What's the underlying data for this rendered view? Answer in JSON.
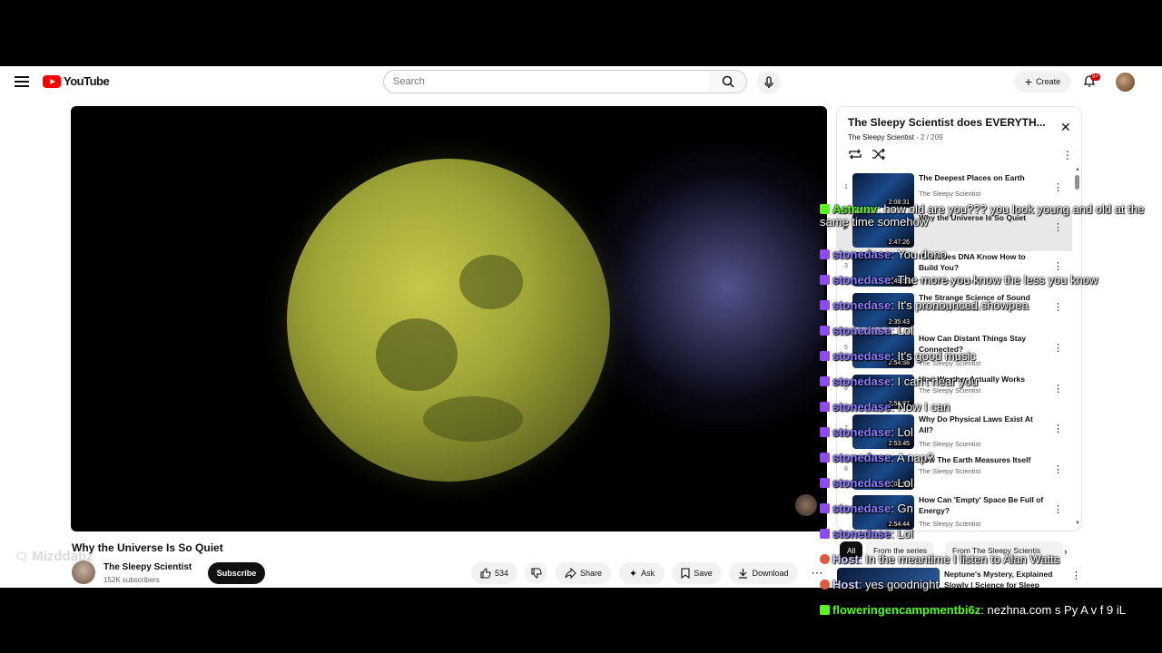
{
  "header": {
    "logo_text": "YouTube",
    "search_placeholder": "Search",
    "create_label": "Create",
    "notif_count": "9+"
  },
  "video": {
    "title": "Why the Universe Is So Quiet"
  },
  "channel": {
    "name": "The Sleepy Scientist",
    "subs": "152K subscribers",
    "subscribe_label": "Subscribe"
  },
  "actions": {
    "likes": "534",
    "share": "Share",
    "ask": "Ask",
    "save": "Save",
    "download": "Download"
  },
  "playlist": {
    "title": "The Sleepy Scientist does EVERYTH...",
    "channel": "The Sleepy Scientist",
    "position": "- 2 / 209",
    "items": [
      {
        "idx": "1",
        "title": "The Deepest Places on Earth",
        "channel": "The Sleepy Scientist",
        "duration": "2:08:31"
      },
      {
        "idx": "",
        "title": "Why the Universe Is So Quiet",
        "channel": "",
        "duration": "2:47:26"
      },
      {
        "idx": "3",
        "title": "How Does DNA Know How to Build You?",
        "channel": "The Sleepy Scientist",
        "duration": "2:49:58"
      },
      {
        "idx": "4",
        "title": "The Strange Science of Sound",
        "channel": "The Sleepy Scientist",
        "duration": "2:35:43"
      },
      {
        "idx": "5",
        "title": "How Can Distant Things Stay Connected?",
        "channel": "The Sleepy Scientist",
        "duration": "2:54:58"
      },
      {
        "idx": "6",
        "title": "How Weather Actually Works",
        "channel": "The Sleepy Scientist",
        "duration": "2:56:07"
      },
      {
        "idx": "7",
        "title": "Why Do Physical Laws Exist At All?",
        "channel": "The Sleepy Scientist",
        "duration": "2:53:45"
      },
      {
        "idx": "8",
        "title": "How The Earth Measures Itself",
        "channel": "The Sleepy Scientist",
        "duration": "3:02:56"
      },
      {
        "idx": "9",
        "title": "How Can 'Empty' Space Be Full of Energy?",
        "channel": "The Sleepy Scientist",
        "duration": "2:54:44"
      }
    ]
  },
  "chips": [
    "All",
    "From the series",
    "From The Sleepy Scientis"
  ],
  "recommended": {
    "title": "Neptune's Mystery, Explained Slowly | Science for Sleep"
  },
  "overlay": {
    "watermark": "Mizddabz"
  },
  "chat": [
    {
      "platform": "kick",
      "name": "Astrunv",
      "text": "how old are you??? you look young and old at the same time somehow"
    },
    {
      "platform": "twitch",
      "name": "stonedase",
      "text": "You dono"
    },
    {
      "platform": "twitch",
      "name": "stonedase",
      "text": "The more you know the less you know"
    },
    {
      "platform": "twitch",
      "name": "stonedase",
      "text": "It's pronounced showpea"
    },
    {
      "platform": "twitch",
      "name": "stonedase",
      "text": "Lol"
    },
    {
      "platform": "twitch",
      "name": "stonedase",
      "text": "It's good music"
    },
    {
      "platform": "twitch",
      "name": "stonedase",
      "text": "I can't hear you"
    },
    {
      "platform": "twitch",
      "name": "stonedase",
      "text": "Now I can"
    },
    {
      "platform": "twitch",
      "name": "stonedase",
      "text": "Lol"
    },
    {
      "platform": "twitch",
      "name": "stonedase",
      "text": "A nap?"
    },
    {
      "platform": "twitch",
      "name": "stonedase",
      "text": "Lol"
    },
    {
      "platform": "twitch",
      "name": "stonedase",
      "text": "Gn"
    },
    {
      "platform": "twitch",
      "name": "stonedase",
      "text": "Lol"
    },
    {
      "platform": "host",
      "name": "Host",
      "text": "In the meantime I listen to Alan Watts"
    },
    {
      "platform": "host",
      "name": "Host",
      "text": "yes goodnight"
    },
    {
      "platform": "kick",
      "name": "floweringencampmentbi6z",
      "text": "nezhna.com s Py A v f 9 iL"
    }
  ],
  "colors": {
    "youtube_red": "#ff0000",
    "twitch": "#9146ff",
    "kick": "#53fc18",
    "twitch_name": "#8a7cff"
  }
}
